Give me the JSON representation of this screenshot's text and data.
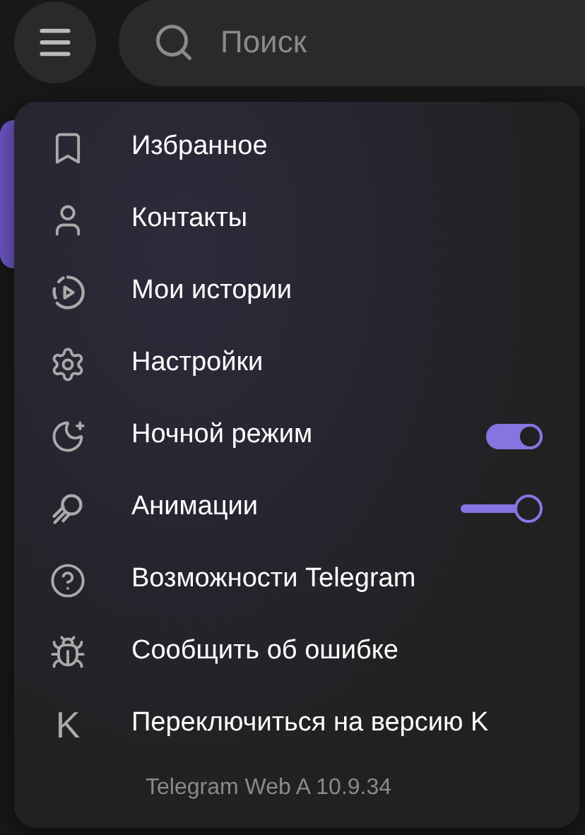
{
  "search": {
    "placeholder": "Поиск"
  },
  "menu": {
    "items": [
      {
        "kind": "link",
        "label": "Избранное"
      },
      {
        "kind": "link",
        "label": "Контакты"
      },
      {
        "kind": "link",
        "label": "Мои истории"
      },
      {
        "kind": "link",
        "label": "Настройки"
      },
      {
        "kind": "toggle",
        "label": "Ночной режим",
        "on": true
      },
      {
        "kind": "slider",
        "label": "Анимации",
        "level": 1
      },
      {
        "kind": "link",
        "label": "Возможности Telegram"
      },
      {
        "kind": "link",
        "label": "Сообщить об ошибке"
      },
      {
        "kind": "link",
        "label": "Переключиться на версию K",
        "glyph": "K"
      }
    ],
    "version": "Telegram Web A 10.9.34"
  }
}
